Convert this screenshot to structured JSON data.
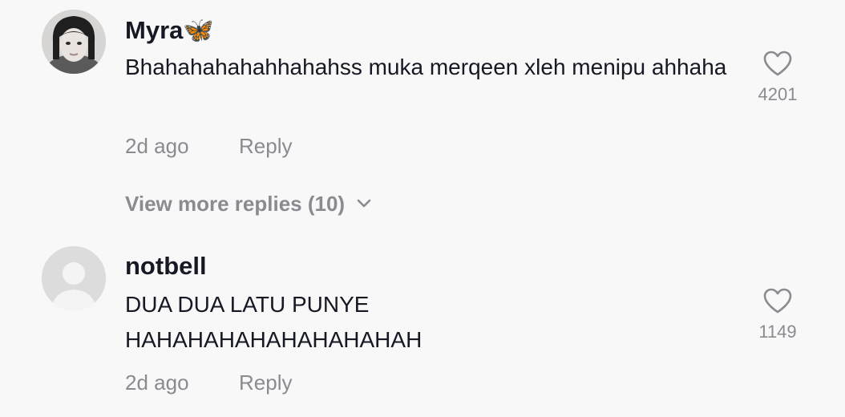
{
  "comments": [
    {
      "username": "Myra🦋",
      "text": "Bhahahahahahhahahss muka merqeen xleh menipu ahhaha",
      "time": "2d ago",
      "reply_label": "Reply",
      "likes": "4201"
    },
    {
      "username": "notbell",
      "text": "DUA DUA LATU PUNYE HAHAHAHAHAHAHAHAHAH",
      "time": "2d ago",
      "reply_label": "Reply",
      "likes": "1149"
    }
  ],
  "view_more_label": "View more replies (10)",
  "icons": {
    "like": "heart-outline-icon",
    "expand": "chevron-down-icon",
    "default_avatar": "person-silhouette-icon"
  },
  "colors": {
    "background": "#f8f8f8",
    "primary_text": "#161823",
    "secondary_text": "#8a8b91",
    "butterfly": "#3aa0f5"
  }
}
